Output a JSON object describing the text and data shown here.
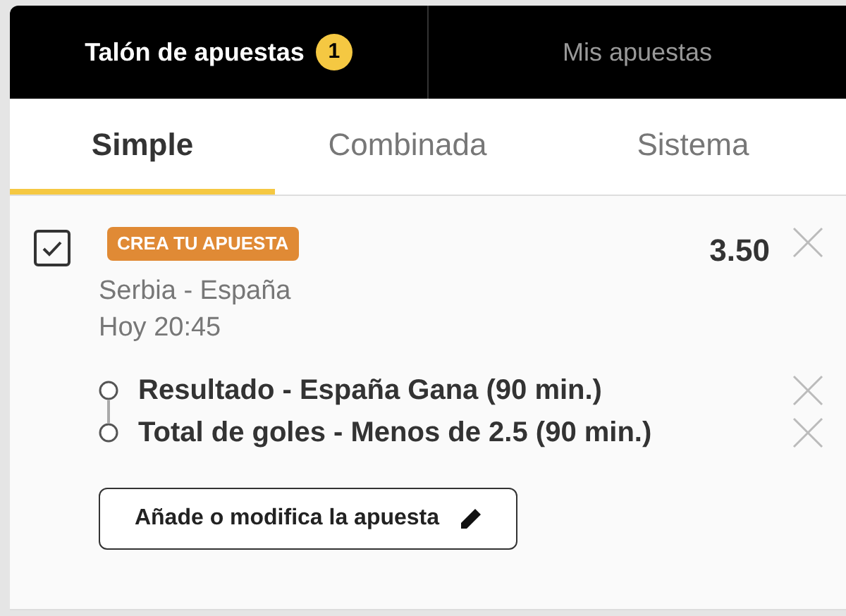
{
  "top_tabs": [
    {
      "label": "Talón de apuestas",
      "badge": "1",
      "selected": true
    },
    {
      "label": "Mis apuestas",
      "selected": false
    }
  ],
  "bet_tabs": [
    {
      "label": "Simple",
      "selected": true
    },
    {
      "label": "Combinada",
      "selected": false
    },
    {
      "label": "Sistema",
      "selected": false
    }
  ],
  "bet": {
    "checked": true,
    "tag": "CREA TU APUESTA",
    "odds": "3.50",
    "match": "Serbia - España",
    "time": "Hoy 20:45",
    "selections": [
      {
        "label": "Resultado - España Gana (90 min.)"
      },
      {
        "label": "Total de goles - Menos de 2.5 (90 min.)"
      }
    ],
    "edit_button": "Añade o modifica la apuesta"
  }
}
